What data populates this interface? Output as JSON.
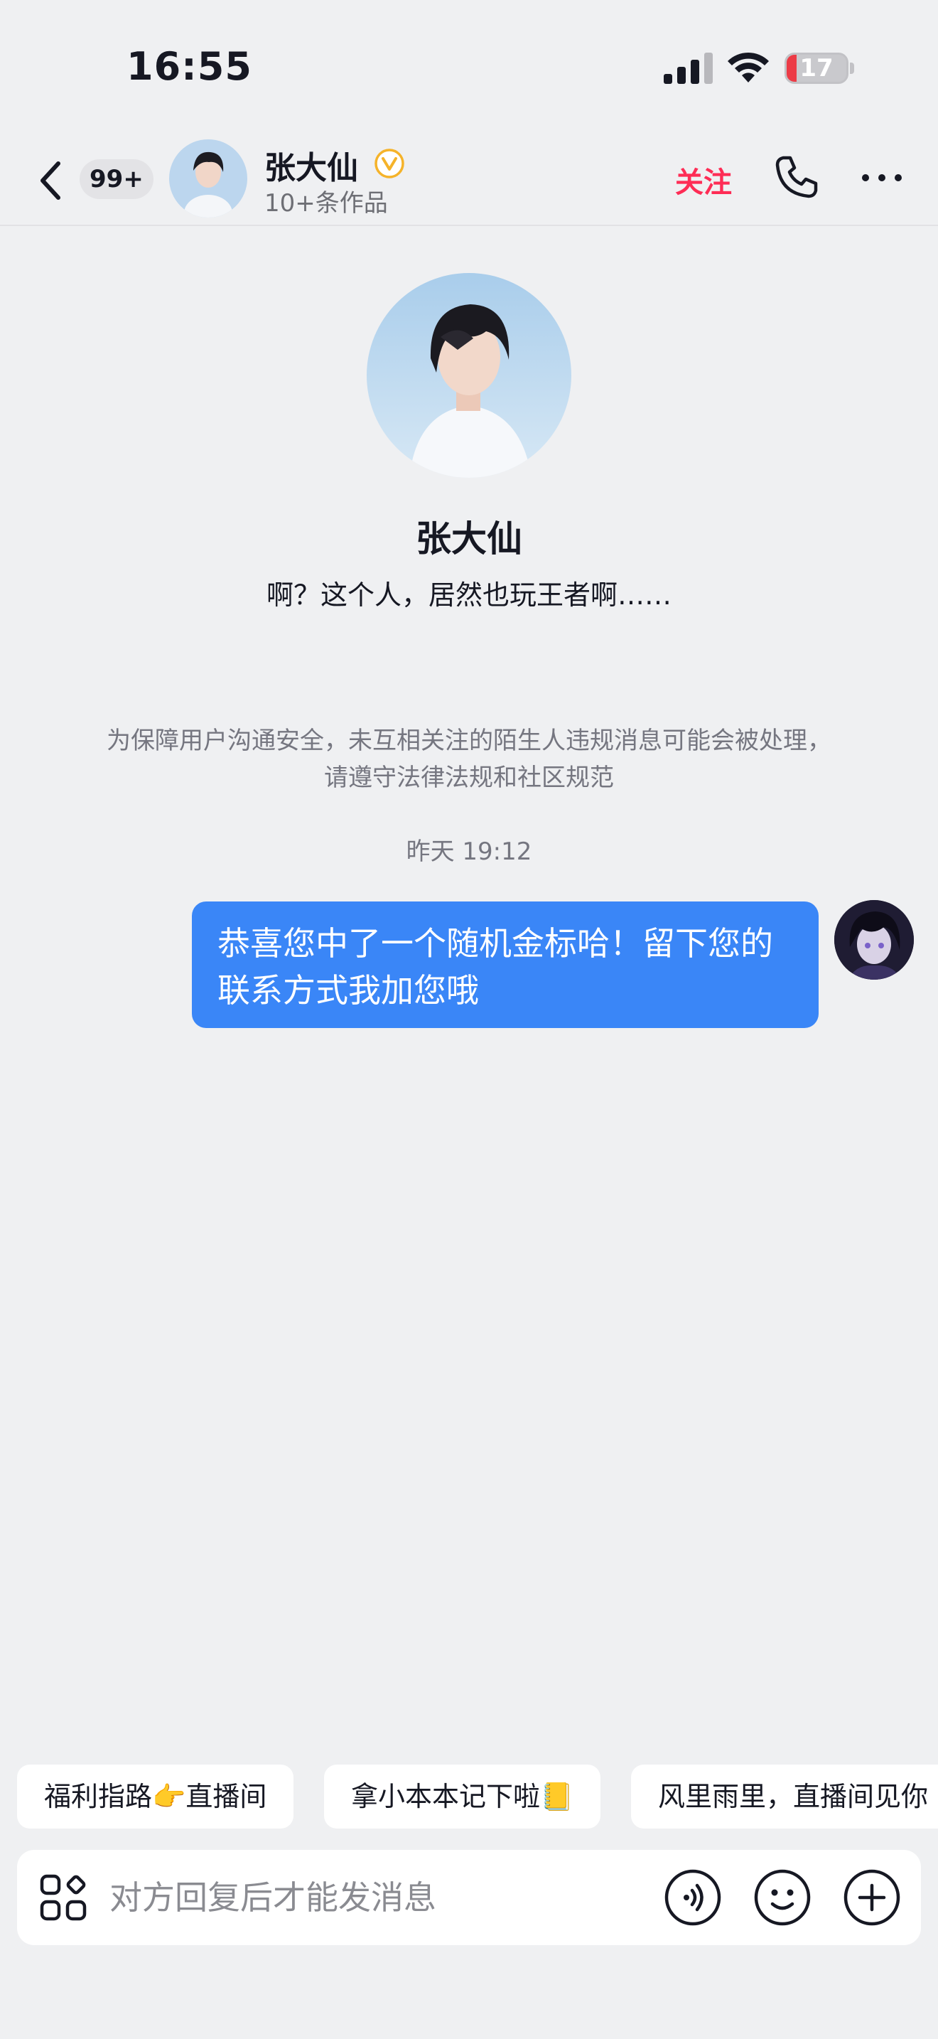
{
  "status_bar": {
    "time": "16:55",
    "battery": "17",
    "battery_level": 0.17,
    "icons": [
      "signal-icon",
      "wifi-icon",
      "battery-icon"
    ]
  },
  "header": {
    "unread_count": "99+",
    "name": "张大仙",
    "subtitle": "10+条作品",
    "follow_label": "关注",
    "icons": [
      "back-icon",
      "verified-icon",
      "phone-icon",
      "more-icon"
    ]
  },
  "profile": {
    "name": "张大仙",
    "signature": "啊？这个人，居然也玩王者啊……"
  },
  "notice": "为保障用户沟通安全，未互相关注的陌生人违规消息可能会被处理，请遵守法律法规和社区规范",
  "timestamp": "昨天 19:12",
  "messages": [
    {
      "from": "me",
      "text": "恭喜您中了一个随机金标哈！留下您的联系方式我加您哦"
    }
  ],
  "quick_replies": [
    "福利指路👉直播间",
    "拿小本本记下啦📒",
    "风里雨里，直播间见你"
  ],
  "input": {
    "placeholder": "对方回复后才能发消息",
    "icons": [
      "apps-icon",
      "voice-icon",
      "emoji-icon",
      "plus-icon"
    ]
  },
  "colors": {
    "background": "#eff0f2",
    "accent_follow": "#fe2c55",
    "bubble": "#3a86f7",
    "verified": "#f5b32a"
  }
}
